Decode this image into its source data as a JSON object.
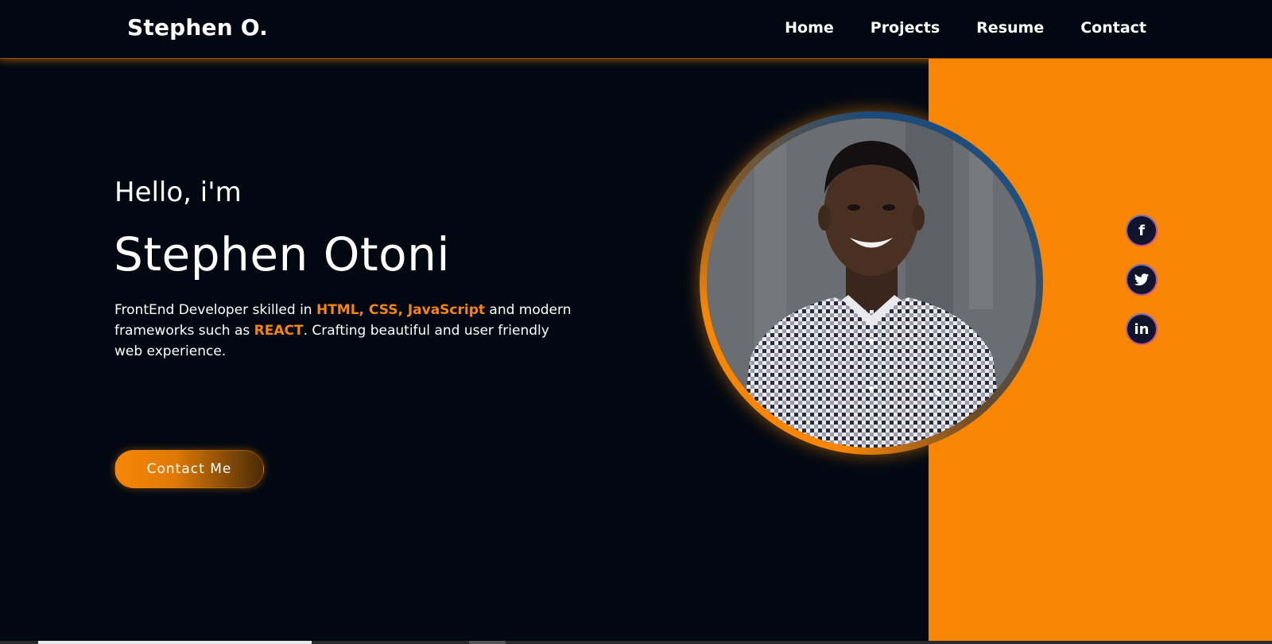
{
  "header": {
    "brand": "Stephen O.",
    "nav": [
      "Home",
      "Projects",
      "Resume",
      "Contact"
    ]
  },
  "hero": {
    "greeting": "Hello, i'm",
    "name": "Stephen Otoni",
    "desc_part1": "FrontEnd Developer skilled in ",
    "desc_hl1": "HTML, CSS, JavaScript",
    "desc_part2": " and modern frameworks such as ",
    "desc_hl2": "REACT",
    "desc_part3": ". Crafting beautiful and user friendly web experience.",
    "button": "Contact Me"
  },
  "social": {
    "facebook": "f",
    "twitter": "t",
    "linkedin": "in"
  },
  "icons": {
    "facebook": "facebook-icon",
    "twitter": "twitter-icon",
    "linkedin": "linkedin-icon"
  },
  "colors": {
    "accent": "#f88604",
    "background": "#020812",
    "text": "#ffffff"
  }
}
